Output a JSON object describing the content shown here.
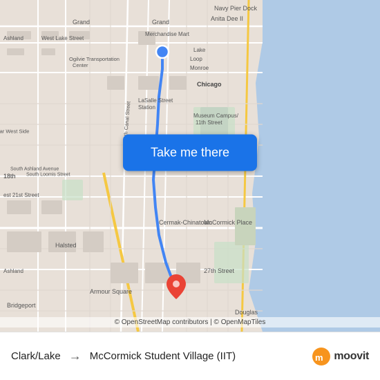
{
  "map": {
    "attribution": "© OpenStreetMap contributors | © OpenMapTiles",
    "button_label": "Take me there",
    "button_bg": "#1a73e8"
  },
  "bottom_bar": {
    "origin": "Clark/Lake",
    "arrow": "→",
    "destination": "McCormick Student Village (IIT)",
    "logo_text": "moovit"
  },
  "icons": {
    "origin_dot": "blue-circle-icon",
    "destination_pin": "red-pin-icon",
    "arrow": "arrow-right-icon"
  }
}
